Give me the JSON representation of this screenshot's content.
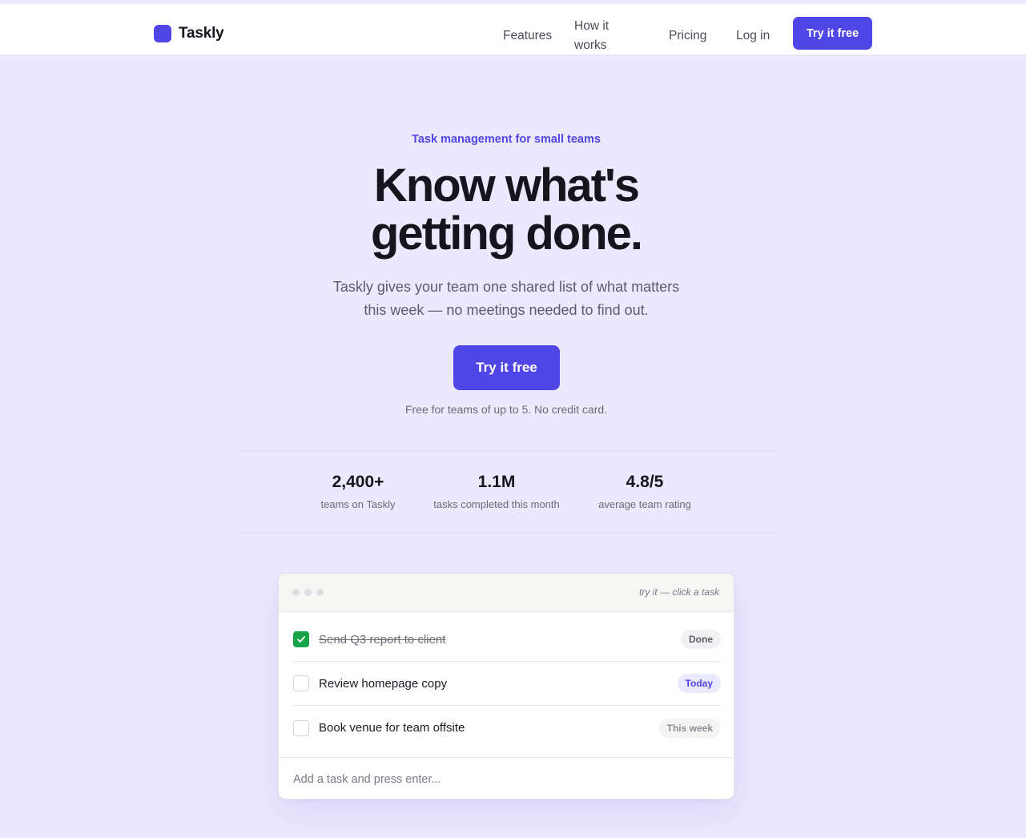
{
  "brand": {
    "name": "Taskly",
    "accent": "#4f46e5"
  },
  "nav": {
    "links": [
      "Features",
      "How it works",
      "Pricing",
      "Log in"
    ],
    "cta": "Try it free"
  },
  "hero": {
    "eyebrow": "Task management for small teams",
    "title_lines": [
      "Know what's",
      "getting done."
    ],
    "subtitle_lines": [
      "Taskly gives your team one shared list of what matters",
      "this week — no meetings needed to find out."
    ],
    "cta": "Try it free",
    "note": "Free for teams of up to 5. No credit card."
  },
  "stats": [
    {
      "value": "2,400+",
      "label": "teams on Taskly"
    },
    {
      "value": "1.1M",
      "label": "tasks completed this month"
    },
    {
      "value": "4.8/5",
      "label": "average team rating"
    }
  ],
  "demo": {
    "hint": "try it — click a task",
    "tasks": [
      {
        "text": "Send Q3 report to client",
        "status": "Done",
        "checked": true
      },
      {
        "text": "Review homepage copy",
        "status": "Today",
        "checked": false
      },
      {
        "text": "Book venue for team offsite",
        "status": "This week",
        "checked": false
      }
    ],
    "add_placeholder": "Add a task and press enter..."
  }
}
